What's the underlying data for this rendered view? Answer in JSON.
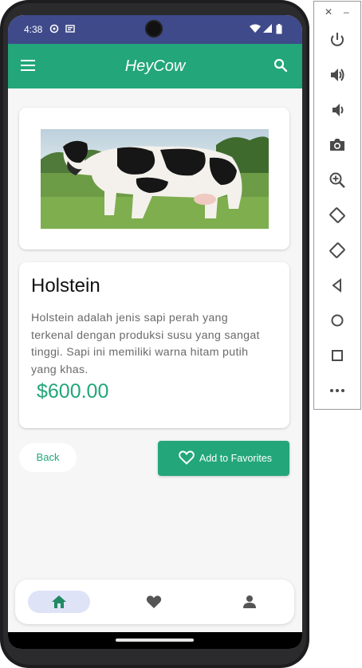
{
  "status_bar": {
    "time": "4:38"
  },
  "app_bar": {
    "title": "HeyCow"
  },
  "product": {
    "name": "Holstein",
    "description": "Holstein adalah jenis sapi perah yang terkenal dengan produksi susu yang sangat tinggi. Sapi ini memiliki warna hitam putih yang khas.",
    "price": "$600.00"
  },
  "actions": {
    "back_label": "Back",
    "favorite_label": "Add to Favorites"
  },
  "bottom_nav": {
    "items": [
      {
        "icon": "home-icon",
        "selected": true
      },
      {
        "icon": "heart-icon",
        "selected": false
      },
      {
        "icon": "person-icon",
        "selected": false
      }
    ]
  },
  "emulator_controls": [
    "close-icon",
    "minimize-icon",
    "power-icon",
    "volume-up-icon",
    "volume-down-icon",
    "camera-icon",
    "zoom-in-icon",
    "rotate-left-icon",
    "rotate-right-icon",
    "back-icon",
    "home-circle-icon",
    "overview-icon",
    "more-icon"
  ],
  "colors": {
    "accent": "#22a67a",
    "status_bar": "#3f4a8a",
    "nav_selected": "#dfe3f7"
  }
}
